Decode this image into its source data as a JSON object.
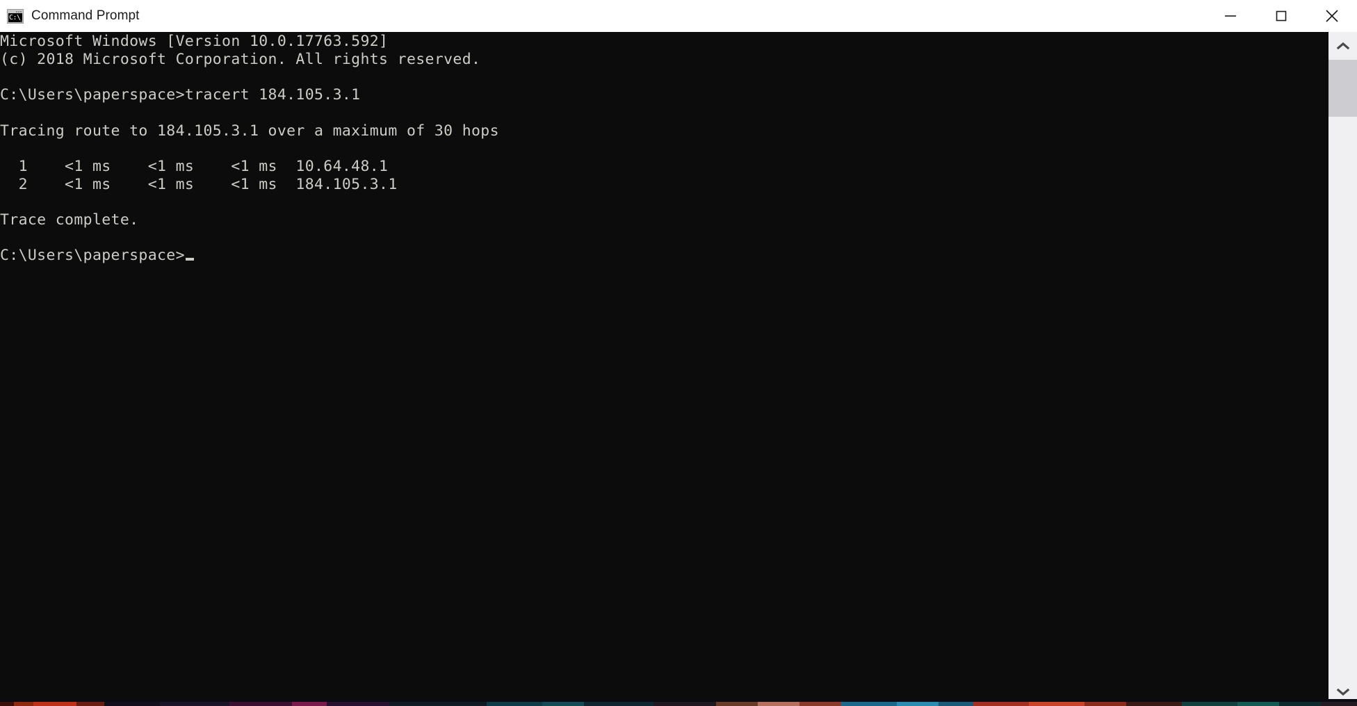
{
  "window": {
    "title": "Command Prompt",
    "icon_name": "cmd-console-icon",
    "icon_text": "C:\\_",
    "colors": {
      "titlebar_bg": "#ffffff",
      "title_text": "#1b1b1b",
      "console_bg": "#0c0c0c",
      "console_text": "#ccccc8",
      "scrollbar_track": "#f0eff2",
      "scrollbar_thumb": "#cdcdd1"
    }
  },
  "window_controls": [
    {
      "name": "minimize",
      "label": "Minimize",
      "glyph": "—"
    },
    {
      "name": "maximize",
      "label": "Maximize",
      "glyph": "□"
    },
    {
      "name": "close",
      "label": "Close",
      "glyph": "✕"
    }
  ],
  "console": {
    "lines": [
      "Microsoft Windows [Version 10.0.17763.592]",
      "(c) 2018 Microsoft Corporation. All rights reserved.",
      "",
      "C:\\Users\\paperspace>tracert 184.105.3.1",
      "",
      "Tracing route to 184.105.3.1 over a maximum of 30 hops",
      "",
      "  1    <1 ms    <1 ms    <1 ms  10.64.48.1",
      "  2    <1 ms    <1 ms    <1 ms  184.105.3.1",
      "",
      "Trace complete.",
      "",
      "C:\\Users\\paperspace>"
    ],
    "text": "Microsoft Windows [Version 10.0.17763.592]\n(c) 2018 Microsoft Corporation. All rights reserved.\n\nC:\\Users\\paperspace>tracert 184.105.3.1\n\nTracing route to 184.105.3.1 over a maximum of 30 hops\n\n  1    <1 ms    <1 ms    <1 ms  10.64.48.1\n  2    <1 ms    <1 ms    <1 ms  184.105.3.1\n\nTrace complete.\n\nC:\\Users\\paperspace>",
    "banner": {
      "os_line": "Microsoft Windows [Version 10.0.17763.592]",
      "os_name": "Microsoft Windows",
      "version": "10.0.17763.592",
      "copyright_line": "(c) 2018 Microsoft Corporation. All rights reserved.",
      "copyright_year": "2018"
    },
    "command": {
      "prompt": "C:\\Users\\paperspace>",
      "command_name": "tracert",
      "argument": "184.105.3.1",
      "full_line": "C:\\Users\\paperspace>tracert 184.105.3.1"
    },
    "trace": {
      "header": "Tracing route to 184.105.3.1 over a maximum of 30 hops",
      "target": "184.105.3.1",
      "max_hops": "30",
      "rows": [
        {
          "hop": "1",
          "rtt1": "<1 ms",
          "rtt2": "<1 ms",
          "rtt3": "<1 ms",
          "address": "10.64.48.1",
          "line": "  1    <1 ms    <1 ms    <1 ms  10.64.48.1"
        },
        {
          "hop": "2",
          "rtt1": "<1 ms",
          "rtt2": "<1 ms",
          "rtt3": "<1 ms",
          "address": "184.105.3.1",
          "line": "  2    <1 ms    <1 ms    <1 ms  184.105.3.1"
        }
      ],
      "footer": "Trace complete."
    },
    "final_prompt": "C:\\Users\\paperspace>",
    "cursor": "_"
  },
  "scrollbar": {
    "up_arrow_name": "chevron-up-icon",
    "down_arrow_name": "chevron-down-icon",
    "thumb_position": "top"
  }
}
